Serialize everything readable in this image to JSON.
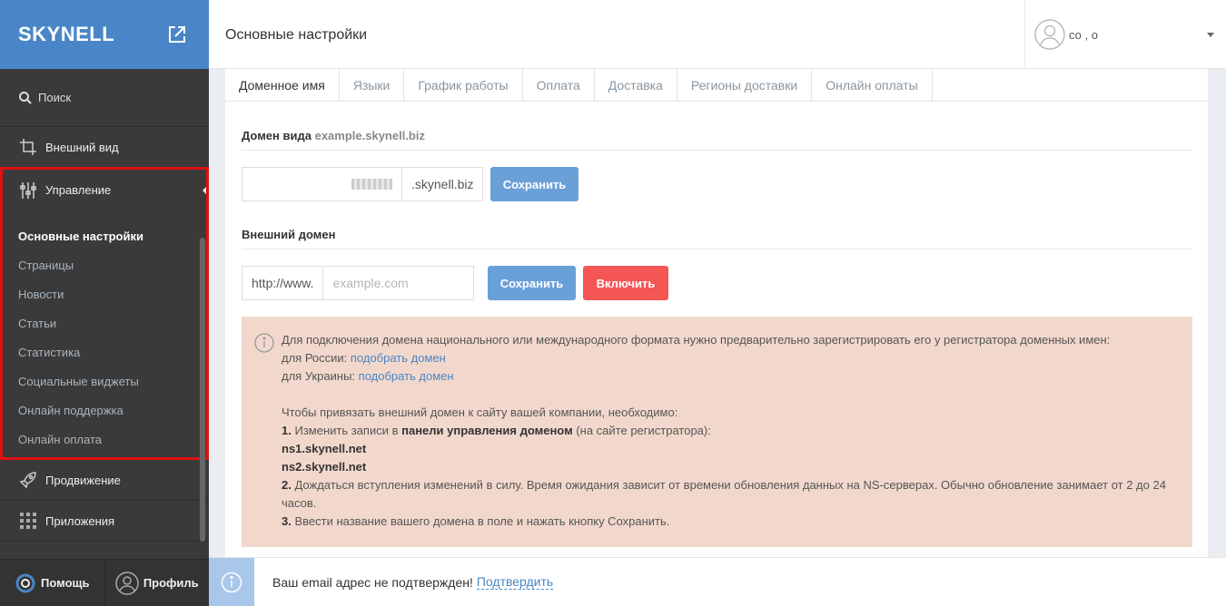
{
  "sidebar": {
    "logo": "SKYNELL",
    "search_label": "Поиск",
    "items": [
      {
        "label": "Внешний вид",
        "icon": "crop-icon"
      },
      {
        "label": "Управление",
        "icon": "sliders-icon"
      },
      {
        "label": "Продвижение",
        "icon": "rocket-icon"
      },
      {
        "label": "Приложения",
        "icon": "grid-icon"
      }
    ],
    "sub_items": [
      {
        "label": "Основные настройки",
        "active": true
      },
      {
        "label": "Страницы"
      },
      {
        "label": "Новости"
      },
      {
        "label": "Статьи"
      },
      {
        "label": "Статистика"
      },
      {
        "label": "Социальные виджеты"
      },
      {
        "label": "Онлайн поддержка"
      },
      {
        "label": "Онлайн оплата"
      }
    ],
    "bottom": {
      "help_label": "Помощь",
      "profile_label": "Профиль"
    }
  },
  "header": {
    "title": "Основные настройки",
    "user_name": "со                        , о"
  },
  "tabs": [
    "Доменное имя",
    "Языки",
    "График работы",
    "Оплата",
    "Доставка",
    "Регионы доставки",
    "Онлайн оплаты"
  ],
  "domain_section": {
    "title": "Домен вида",
    "title_example": "example.skynell.biz",
    "suffix": ".skynell.biz",
    "save_label": "Сохранить"
  },
  "external_section": {
    "title": "Внешний домен",
    "prefix": "http://www.",
    "placeholder": "example.com",
    "save_label": "Сохранить",
    "enable_label": "Включить"
  },
  "info": {
    "line1": "Для подключения домена национального или международного формата нужно предварительно зарегистрировать его у регистратора доменных имен:",
    "russia_prefix": "для России:",
    "russia_link": "подобрать домен",
    "ukraine_prefix": "для Украины:",
    "ukraine_link": "подобрать домен",
    "intro": "Чтобы привязать внешний домен к сайту вашей компании, необходимо:",
    "step1_num": "1.",
    "step1_a": "Изменить записи в",
    "step1_b": "панели управления доменом",
    "step1_c": "(на сайте регистратора):",
    "ns1": "ns1.skynell.net",
    "ns2": "ns2.skynell.net",
    "step2_num": "2.",
    "step2": "Дождаться вступления изменений в силу. Время ожидания зависит от времени обновления данных на NS-серверах. Обычно обновление занимает от 2 до 24 часов.",
    "step3_num": "3.",
    "step3": "Ввести название вашего домена в поле и нажать кнопку Сохранить."
  },
  "notification": {
    "text": "Ваш email адрес не подтвержден!",
    "link": "Подтвердить"
  },
  "colors": {
    "sidebar_bg": "#3a3a3a",
    "accent_blue": "#4a86c7",
    "button_blue": "#6aa0d8",
    "button_red": "#f45656",
    "info_bg": "#f2d8cc",
    "highlight_border": "#e01010"
  }
}
